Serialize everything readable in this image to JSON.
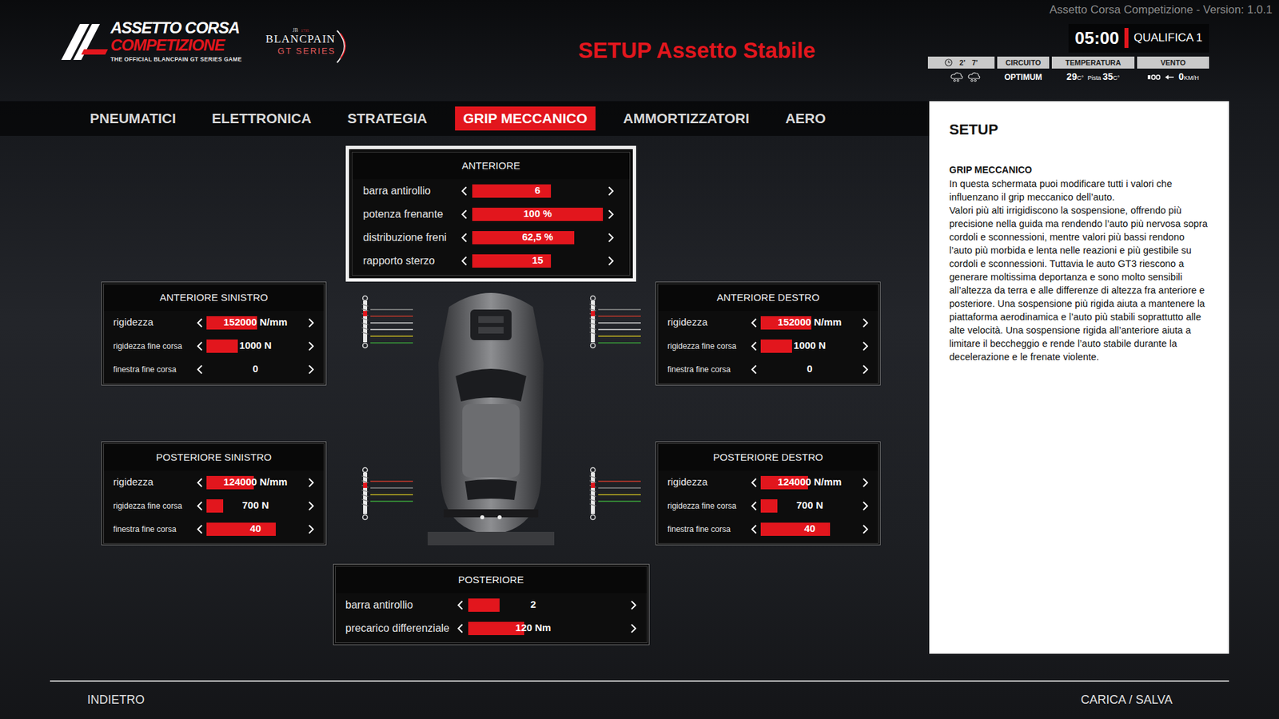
{
  "app": {
    "version": "Assetto Corsa Competizione - Version: 1.0.1",
    "logo": {
      "line1": "ASSETTO CORSA",
      "line2": "COMPETIZIONE",
      "tagline": "THE OFFICIAL BLANCPAIN GT SERIES GAME"
    },
    "sponsor": {
      "mark": "JB",
      "year": "1735",
      "name": "BLANCPAIN",
      "series": "GT SERIES"
    }
  },
  "title": "SETUP Assetto Stabile",
  "session": {
    "time": "05:00",
    "name": "QUALIFICA 1"
  },
  "conditions": {
    "forecast": [
      {
        "time": "2'"
      },
      {
        "time": "7'"
      }
    ],
    "track": {
      "label": "CIRCUITO",
      "value": "OPTIMUM"
    },
    "temperature": {
      "label": "TEMPERATURA",
      "air": "29",
      "air_unit": "C°",
      "track_label": "Pista",
      "track": "35",
      "track_unit": "C°"
    },
    "wind": {
      "label": "VENTO",
      "speed": "0",
      "unit": "KM/H"
    }
  },
  "tabs": [
    {
      "label": "PNEUMATICI",
      "selected": false
    },
    {
      "label": "ELETTRONICA",
      "selected": false
    },
    {
      "label": "STRATEGIA",
      "selected": false
    },
    {
      "label": "GRIP MECCANICO",
      "selected": true
    },
    {
      "label": "AMMORTIZZATORI",
      "selected": false
    },
    {
      "label": "AERO",
      "selected": false
    }
  ],
  "front": {
    "title": "ANTERIORE",
    "focused": true,
    "rows": [
      {
        "label": "barra antirollio",
        "value": "6",
        "level": 0.6
      },
      {
        "label": "potenza frenante",
        "value": "100 %",
        "level": 1.0
      },
      {
        "label": "distribuzione freni",
        "value": "62,5 %",
        "level": 0.78
      },
      {
        "label": "rapporto sterzo",
        "value": "15",
        "level": 0.6
      }
    ]
  },
  "corners": [
    {
      "title": "ANTERIORE SINISTRO",
      "focused": false,
      "rows": [
        {
          "label": "rigidezza",
          "value": "152000 N/mm",
          "level": 0.52
        },
        {
          "label": "rigidezza fine corsa",
          "value": "1000 N",
          "level": 0.32
        },
        {
          "label": "finestra fine corsa",
          "value": "0",
          "level": 0
        }
      ]
    },
    {
      "title": "ANTERIORE DESTRO",
      "focused": false,
      "rows": [
        {
          "label": "rigidezza",
          "value": "152000 N/mm",
          "level": 0.52
        },
        {
          "label": "rigidezza fine corsa",
          "value": "1000 N",
          "level": 0.32
        },
        {
          "label": "finestra fine corsa",
          "value": "0",
          "level": 0
        }
      ]
    },
    {
      "title": "POSTERIORE SINISTRO",
      "focused": false,
      "rows": [
        {
          "label": "rigidezza",
          "value": "124000 N/mm",
          "level": 0.48
        },
        {
          "label": "rigidezza fine corsa",
          "value": "700 N",
          "level": 0.17
        },
        {
          "label": "finestra fine corsa",
          "value": "40",
          "level": 0.71
        }
      ]
    },
    {
      "title": "POSTERIORE DESTRO",
      "focused": false,
      "rows": [
        {
          "label": "rigidezza",
          "value": "124000 N/mm",
          "level": 0.48
        },
        {
          "label": "rigidezza fine corsa",
          "value": "700 N",
          "level": 0.17
        },
        {
          "label": "finestra fine corsa",
          "value": "40",
          "level": 0.71
        }
      ]
    }
  ],
  "rear": {
    "title": "POSTERIORE",
    "focused": false,
    "rows": [
      {
        "label": "barra antirollio",
        "value": "2",
        "level": 0.24
      },
      {
        "label": "precarico differenziale",
        "value": "120 Nm",
        "level": 0.43
      }
    ]
  },
  "help": {
    "heading": "SETUP",
    "subheading": "GRIP MECCANICO",
    "paragraphs": [
      "In questa schermata puoi modificare tutti i valori che influenzano il grip meccanico dell’auto.",
      "Valori più alti irrigidiscono la sospensione, offrendo più precisione nella guida ma rendendo l’auto più nervosa sopra cordoli e sconnessioni, mentre valori più bassi rendono l’auto più morbida e lenta nelle reazioni e più gestibile su cordoli e sconnessioni. Tuttavia le auto GT3 riescono a generare moltissima deportanza e sono molto sensibili all’altezza da terra e alle differenze di altezza fra anteriore e posteriore. Una sospensione più rigida aiuta a mantenere la piattaforma aerodinamica e l’auto più stabili soprattutto alle alte velocità. Una sospensione rigida all’anteriore aiuta a limitare il beccheggio e rende l’auto stabile durante la decelerazione e le frenate violente."
    ]
  },
  "footer": {
    "back": "INDIETRO",
    "load_save": "CARICA / SALVA"
  }
}
